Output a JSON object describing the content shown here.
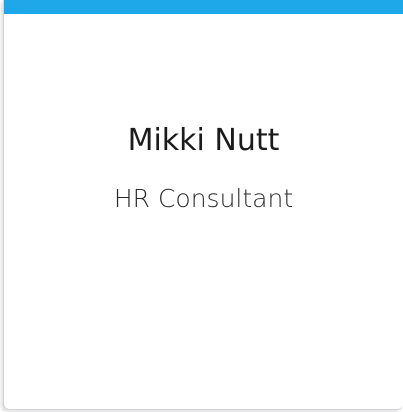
{
  "card": {
    "name": "Mikki Nutt",
    "job_title": "HR Consultant"
  },
  "colors": {
    "accent": "#1ea7e9",
    "name_text": "#1b1b1b",
    "title_text": "#2a2a2a"
  }
}
